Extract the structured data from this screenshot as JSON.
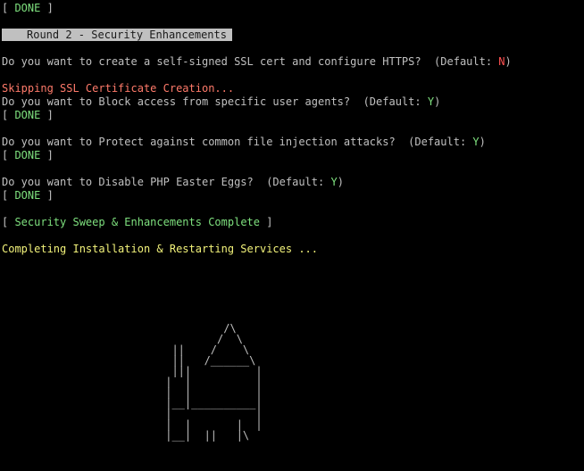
{
  "terminal": {
    "done_line": "[ DONE ]",
    "done_open": "[ ",
    "done_word": "DONE",
    "done_close": " ]",
    "banner": "Round 2 - Security Enhancements",
    "q_ssl_prefix": "Do you want to create a self-signed SSL cert and configure HTTPS?  (Default: ",
    "q_ssl_default": "N",
    "q_close": ")",
    "ssl_skip": "Skipping SSL Certificate Creation...",
    "q_agents_prefix": "Do you want to Block access from specific user agents?  (Default: ",
    "q_agents_default": "Y",
    "q_injection_prefix": "Do you want to Protect against common file injection attacks?  (Default: ",
    "q_injection_default": "Y",
    "q_php_prefix": "Do you want to Disable PHP Easter Eggs?  (Default: ",
    "q_php_default": "Y",
    "sweep_open": "[ ",
    "sweep_text": "Security Sweep & Enhancements Complete",
    "sweep_close": " ]",
    "completing": "Completing Installation & Restarting Services ..."
  },
  "rocket_art": "          /\\\n         /  \\\n  ||    /    \\\n  ||   /______\\\n  |||          |\n |  |          |\n |  |          |\n |__|__________|\n |             |\n |  |       |  |\n |__|  ||   |\\",
  "colors": {
    "background": "#000000",
    "text": "#c0c0c0",
    "green": "#7ee07e",
    "red": "#ff5050",
    "salmon": "#ff7a6a",
    "yellow": "#f2f27a"
  }
}
